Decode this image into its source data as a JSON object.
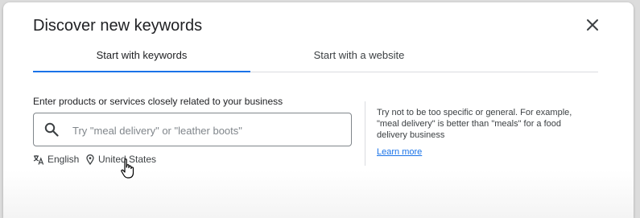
{
  "dialog": {
    "title": "Discover new keywords",
    "close_icon": "close-icon"
  },
  "tabs": [
    {
      "label": "Start with keywords",
      "active": true
    },
    {
      "label": "Start with a website",
      "active": false
    }
  ],
  "form": {
    "prompt": "Enter products or services closely related to your business",
    "search_placeholder": "Try \"meal delivery\" or \"leather boots\"",
    "search_value": "",
    "language_label": "English",
    "location_label": "United States"
  },
  "tip": {
    "text": "Try not to be too specific or general. For example, \"meal delivery\" is better than \"meals\" for a food delivery business",
    "link_label": "Learn more"
  },
  "colors": {
    "accent": "#1a73e8",
    "text_primary": "#202124",
    "text_secondary": "#3c4043"
  }
}
